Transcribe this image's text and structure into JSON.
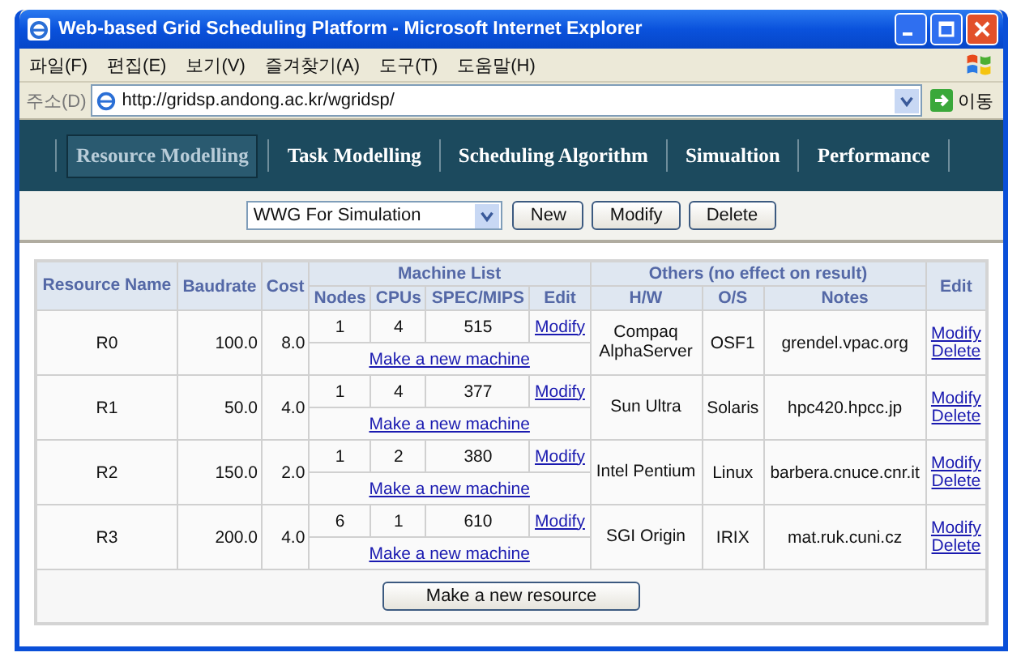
{
  "window": {
    "title": "Web-based Grid Scheduling Platform - Microsoft Internet Explorer"
  },
  "menu": [
    "파일(F)",
    "편집(E)",
    "보기(V)",
    "즐겨찾기(A)",
    "도구(T)",
    "도움말(H)"
  ],
  "address_bar": {
    "label": "주소(D)",
    "url": "http://gridsp.andong.ac.kr/wgridsp/",
    "go": "이동"
  },
  "nav_tabs": [
    {
      "label": "Resource Modelling",
      "selected": true
    },
    {
      "label": "Task Modelling",
      "selected": false
    },
    {
      "label": "Scheduling Algorithm",
      "selected": false
    },
    {
      "label": "Simualtion",
      "selected": false
    },
    {
      "label": "Performance",
      "selected": false
    }
  ],
  "toolbar": {
    "dropdown": "WWG For Simulation",
    "buttons": [
      "New",
      "Modify",
      "Delete"
    ]
  },
  "table": {
    "headers": {
      "resource_name": "Resource Name",
      "baudrate": "Baudrate",
      "cost": "Cost",
      "machine_list": "Machine List",
      "others": "Others (no effect on result)",
      "edit": "Edit"
    },
    "machine_columns": [
      "Nodes",
      "CPUs",
      "SPEC/MIPS",
      "Edit"
    ],
    "other_columns": [
      "H/W",
      "O/S",
      "Notes"
    ],
    "rows": [
      {
        "name": "R0",
        "baudrate": "100.0",
        "cost": "8.0",
        "machines": [
          {
            "nodes": "1",
            "cpus": "4",
            "spec": "515",
            "edit": "Modify"
          }
        ],
        "new_machine": "Make a new machine",
        "hw": "Compaq AlphaServer",
        "os": "OSF1",
        "notes": "grendel.vpac.org",
        "actions": [
          "Modify",
          "Delete"
        ]
      },
      {
        "name": "R1",
        "baudrate": "50.0",
        "cost": "4.0",
        "machines": [
          {
            "nodes": "1",
            "cpus": "4",
            "spec": "377",
            "edit": "Modify"
          }
        ],
        "new_machine": "Make a new machine",
        "hw": "Sun Ultra",
        "os": "Solaris",
        "notes": "hpc420.hpcc.jp",
        "actions": [
          "Modify",
          "Delete"
        ]
      },
      {
        "name": "R2",
        "baudrate": "150.0",
        "cost": "2.0",
        "machines": [
          {
            "nodes": "1",
            "cpus": "2",
            "spec": "380",
            "edit": "Modify"
          }
        ],
        "new_machine": "Make a new machine",
        "hw": "Intel Pentium",
        "os": "Linux",
        "notes": "barbera.cnuce.cnr.it",
        "actions": [
          "Modify",
          "Delete"
        ]
      },
      {
        "name": "R3",
        "baudrate": "200.0",
        "cost": "4.0",
        "machines": [
          {
            "nodes": "6",
            "cpus": "1",
            "spec": "610",
            "edit": "Modify"
          }
        ],
        "new_machine": "Make a new machine",
        "hw": "SGI Origin",
        "os": "IRIX",
        "notes": "mat.ruk.cuni.cz",
        "actions": [
          "Modify",
          "Delete"
        ]
      }
    ],
    "new_resource": "Make a new resource"
  }
}
